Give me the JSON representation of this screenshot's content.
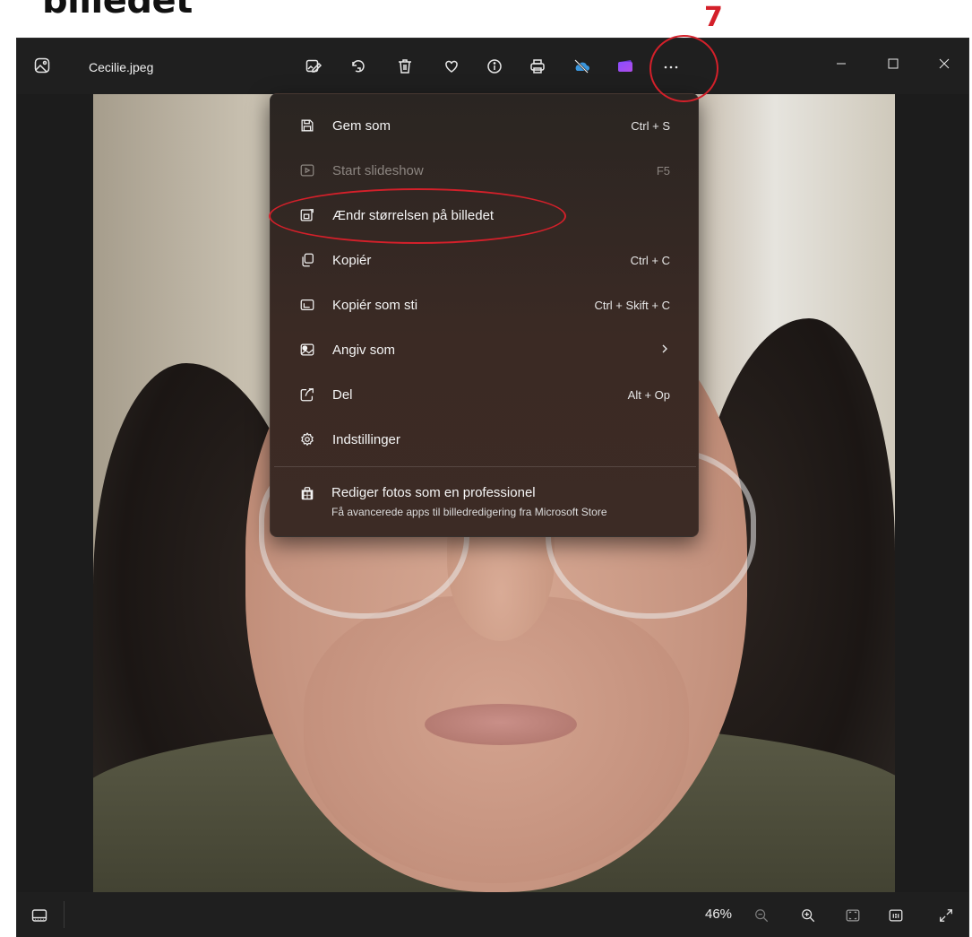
{
  "annotation": {
    "heading": "billedet",
    "step_number": "7",
    "highlight_color": "#d4202a"
  },
  "window": {
    "file_name": "Cecilie.jpeg",
    "toolbar_icons": [
      "edit-image-icon",
      "rotate-icon",
      "delete-icon",
      "favorite-icon",
      "info-icon",
      "print-icon",
      "onedrive-icon",
      "clipchamp-icon",
      "more-options-icon"
    ],
    "window_controls": [
      "minimize-icon",
      "maximize-icon",
      "close-icon"
    ]
  },
  "context_menu": {
    "items": [
      {
        "label": "Gem som",
        "shortcut": "Ctrl + S",
        "icon": "save-icon",
        "disabled": false
      },
      {
        "label": "Start slideshow",
        "shortcut": "F5",
        "icon": "slideshow-icon",
        "disabled": true
      },
      {
        "label": "Ændr størrelsen på billedet",
        "shortcut": "",
        "icon": "resize-image-icon",
        "disabled": false
      },
      {
        "label": "Kopiér",
        "shortcut": "Ctrl + C",
        "icon": "copy-icon",
        "disabled": false
      },
      {
        "label": "Kopiér som sti",
        "shortcut": "Ctrl + Skift + C",
        "icon": "copy-path-icon",
        "disabled": false
      },
      {
        "label": "Angiv som",
        "shortcut": "",
        "icon": "set-as-icon",
        "disabled": false,
        "submenu": true
      },
      {
        "label": "Del",
        "shortcut": "Alt + Op",
        "icon": "share-icon",
        "disabled": false
      },
      {
        "label": "Indstillinger",
        "shortcut": "",
        "icon": "settings-icon",
        "disabled": false
      }
    ],
    "promo": {
      "title": "Rediger fotos som en professionel",
      "subtitle": "Få avancerede apps til billedredigering fra Microsoft Store",
      "icon": "microsoft-store-icon"
    }
  },
  "status_bar": {
    "zoom_level": "46%",
    "icons": [
      "filmstrip-icon",
      "zoom-out-icon",
      "zoom-in-icon",
      "fit-to-window-icon",
      "actual-size-icon",
      "fullscreen-icon"
    ]
  }
}
